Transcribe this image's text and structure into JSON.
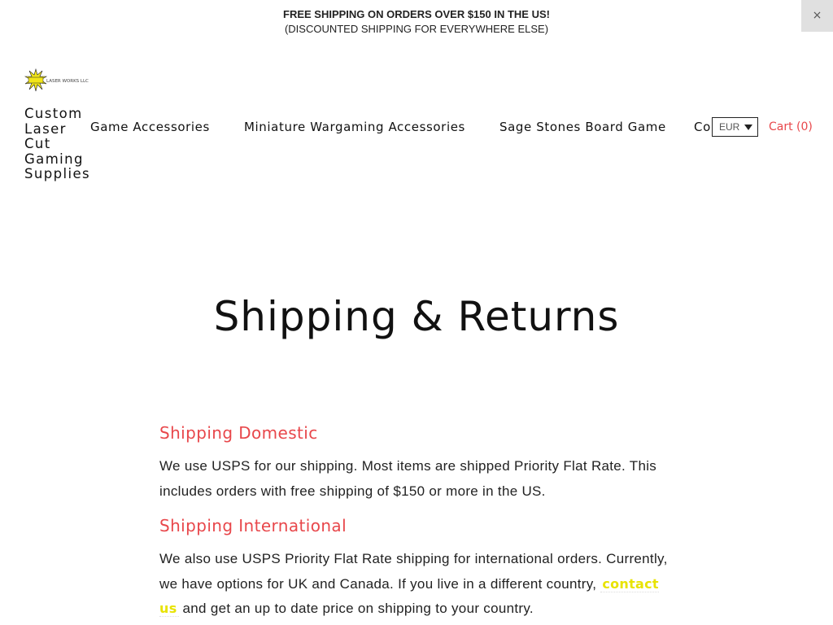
{
  "promo": {
    "line1": "FREE SHIPPING ON ORDERS OVER $150 IN THE US!",
    "line2": "(DISCOUNTED SHIPPING FOR EVERYWHERE ELSE)",
    "close_label": "×"
  },
  "header": {
    "logo_text": "LASER WORKS LLC",
    "brand_lines": [
      "Custom",
      "Laser",
      "Cut",
      "Gaming",
      "Supplies"
    ],
    "nav": [
      {
        "label": "Game Accessories"
      },
      {
        "label": "Miniature Wargaming Accessories"
      },
      {
        "label": "Sage Stones Board Game"
      },
      {
        "label": "Contact"
      }
    ],
    "currency": {
      "selected": "EUR"
    },
    "cart_label": "Cart (0)"
  },
  "main": {
    "title": "Shipping & Returns",
    "sections": [
      {
        "heading": "Shipping Domestic",
        "text": "We use USPS for our shipping. Most items are shipped Priority Flat Rate. This includes orders with free shipping of $150 or more in the US."
      },
      {
        "heading": "Shipping International",
        "text_before": "We also use USPS Priority Flat Rate shipping for international orders. Currently, we have options for UK and Canada. If you live in a different country, ",
        "link": "contact us",
        "text_after": " and get an up to date price on shipping to your country."
      }
    ]
  },
  "colors": {
    "accent": "#e8474b",
    "link": "#e8e300"
  }
}
